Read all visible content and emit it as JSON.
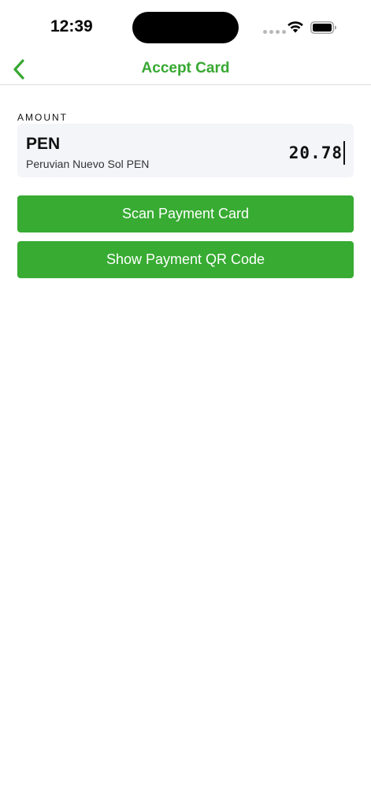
{
  "status_bar": {
    "time": "12:39"
  },
  "nav": {
    "title": "Accept Card",
    "back_icon": "chevron-left-icon"
  },
  "amount": {
    "label": "AMOUNT",
    "currency_code": "PEN",
    "currency_name": "Peruvian Nuevo Sol PEN",
    "value": "20.78"
  },
  "buttons": {
    "scan_label": "Scan Payment Card",
    "qr_label": "Show Payment QR Code"
  },
  "colors": {
    "accent": "#37a832",
    "button_bg": "#37ab32",
    "amount_bg": "#f4f5f9"
  }
}
